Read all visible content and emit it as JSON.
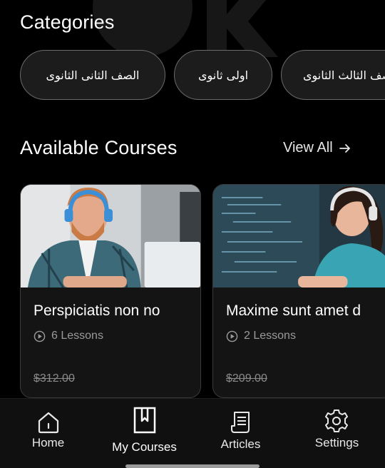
{
  "categories": {
    "title": "Categories",
    "chips": [
      {
        "label": "الصف الثانى الثانوى"
      },
      {
        "label": "اولى ثانوى"
      },
      {
        "label": "الصف الثالث الثانوى"
      }
    ]
  },
  "courses": {
    "title": "Available Courses",
    "view_all": "View All",
    "items": [
      {
        "name": "Perspiciatis non no",
        "lessons": "6 Lessons",
        "price": "$312.00"
      },
      {
        "name": "Maxime sunt amet d",
        "lessons": "2 Lessons",
        "price": "$209.00"
      }
    ]
  },
  "nav": {
    "items": [
      {
        "label": "Home",
        "icon": "home-icon"
      },
      {
        "label": "My Courses",
        "icon": "bookmark-book-icon"
      },
      {
        "label": "Articles",
        "icon": "articles-icon"
      },
      {
        "label": "Settings",
        "icon": "gear-icon"
      }
    ],
    "active": "My Courses"
  },
  "colors": {
    "background": "#000000",
    "chip_border": "#6a6a6a",
    "card_bg": "#141414",
    "nav_bg": "#101010"
  }
}
